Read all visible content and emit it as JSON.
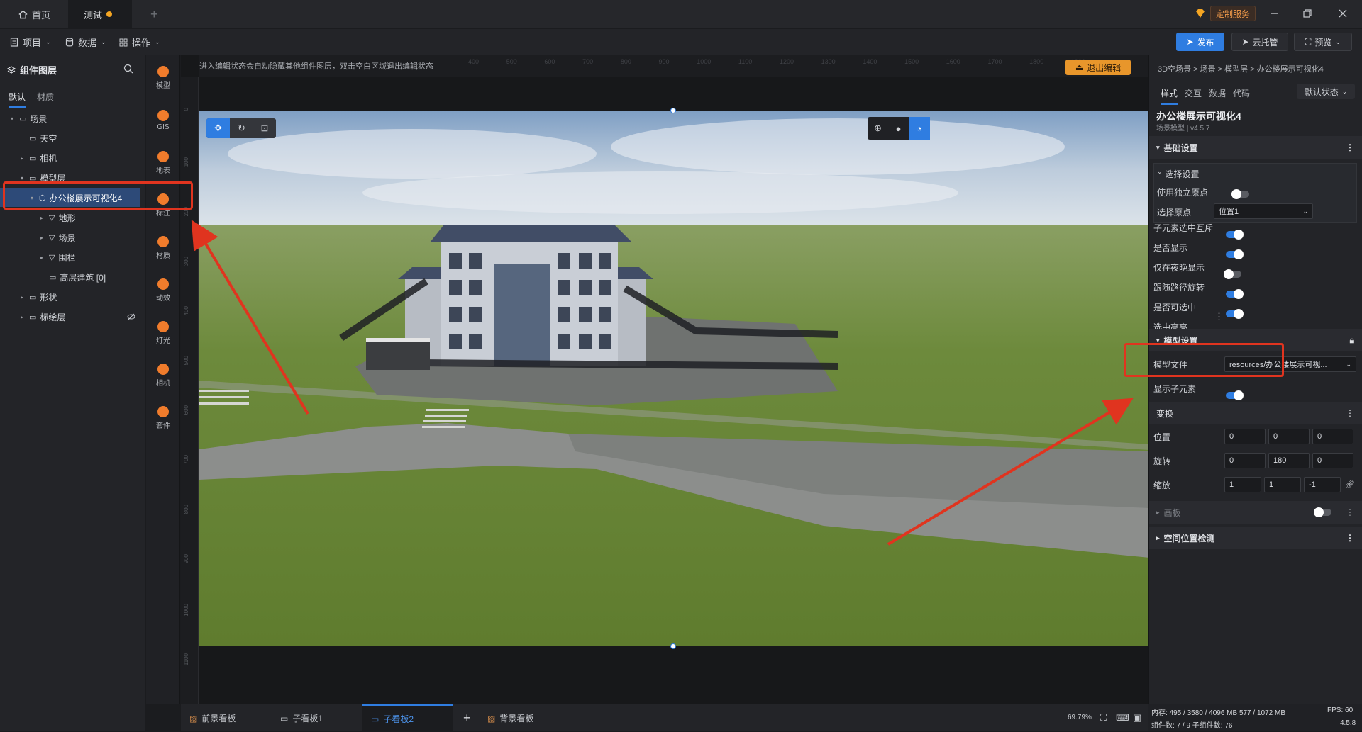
{
  "tabs": {
    "home": "首页",
    "test": "测试",
    "add": "+"
  },
  "window": {
    "custom_service": "定制服务"
  },
  "toolbar": {
    "project": "项目",
    "data": "数据",
    "operate": "操作",
    "publish": "发布",
    "cloud": "云托管",
    "preview": "预览"
  },
  "left_panel": {
    "title": "组件图层",
    "tabs": [
      "默认",
      "材质"
    ],
    "tree": [
      {
        "label": "场景",
        "indent": 0,
        "caret": "▾"
      },
      {
        "label": "天空",
        "indent": 1,
        "caret": ""
      },
      {
        "label": "相机",
        "indent": 1,
        "caret": "▸"
      },
      {
        "label": "模型层",
        "indent": 1,
        "caret": "▾"
      },
      {
        "label": "办公楼展示可视化4",
        "indent": 2,
        "caret": "▾"
      },
      {
        "label": "地形",
        "indent": 3,
        "caret": "▸"
      },
      {
        "label": "场景",
        "indent": 3,
        "caret": "▸"
      },
      {
        "label": "围栏",
        "indent": 3,
        "caret": "▸"
      },
      {
        "label": "高层建筑 [0]",
        "indent": 3,
        "caret": ""
      },
      {
        "label": "形状",
        "indent": 1,
        "caret": "▸"
      },
      {
        "label": "标绘层",
        "indent": 1,
        "caret": "▸"
      }
    ]
  },
  "icon_column": [
    "模型",
    "GIS",
    "地表",
    "标注",
    "材质",
    "动效",
    "灯光",
    "相机",
    "套件"
  ],
  "canvas": {
    "hint": "进入编辑状态会自动隐藏其他组件图层，双击空白区域退出编辑状态",
    "exit_edit": "退出编辑",
    "ruler_top": [
      "400",
      "500",
      "600",
      "700",
      "800",
      "900",
      "1000",
      "1100",
      "1200",
      "1300",
      "1400",
      "1500",
      "1600",
      "1700",
      "1800",
      "1900"
    ],
    "ruler_left": [
      "0",
      "100",
      "200",
      "300",
      "400",
      "500",
      "600",
      "700",
      "800",
      "900",
      "1000",
      "1100"
    ]
  },
  "right_panel": {
    "breadcrumb": "3D空场景 > 场景 > 模型层 > 办公楼展示可视化4",
    "tabs": [
      "样式",
      "交互",
      "数据",
      "代码"
    ],
    "state": "默认状态",
    "component_name": "办公楼展示可视化4",
    "component_sub": "场景模型 | v4.5.7",
    "basic_settings": "基础设置",
    "selection_settings": "选择设置",
    "use_independent_origin": "使用独立原点",
    "selection_origin": "选择原点",
    "selection_origin_value": "位置1",
    "toggles": [
      {
        "label": "子元素选中互斥",
        "on": true
      },
      {
        "label": "是否显示",
        "on": true
      },
      {
        "label": "仅在夜晚显示",
        "on": false
      },
      {
        "label": "跟随路径旋转",
        "on": true
      },
      {
        "label": "是否可选中",
        "on": true
      },
      {
        "label": "选中高亮",
        "on": false
      }
    ],
    "model_settings": "模型设置",
    "model_file": "模型文件",
    "model_file_value": "resources/办公楼展示可视...",
    "show_children": "显示子元素",
    "transform": "变换",
    "position": {
      "label": "位置",
      "values": [
        "0",
        "0",
        "0"
      ]
    },
    "rotation": {
      "label": "旋转",
      "values": [
        "0",
        "180",
        "0"
      ]
    },
    "scale": {
      "label": "缩放",
      "values": [
        "1",
        "1",
        "-1"
      ]
    },
    "panel": "画板",
    "space_check": "空间位置检测"
  },
  "bottom": {
    "tabs": [
      "前景看板",
      "子看板1",
      "子看板2",
      "背景看板"
    ],
    "add": "+",
    "zoom": "69.79%"
  },
  "status": {
    "memory": "内存:  495 / 3580 / 4096 MB  577 / 1072 MB",
    "fps": "FPS:  60",
    "components": "组件数: 7 / 9   子组件数: 76",
    "version": "4.5.8"
  },
  "colors": {
    "accent": "#2f7de1",
    "annotation": "#e0341f",
    "exit_button": "#e8962b"
  }
}
